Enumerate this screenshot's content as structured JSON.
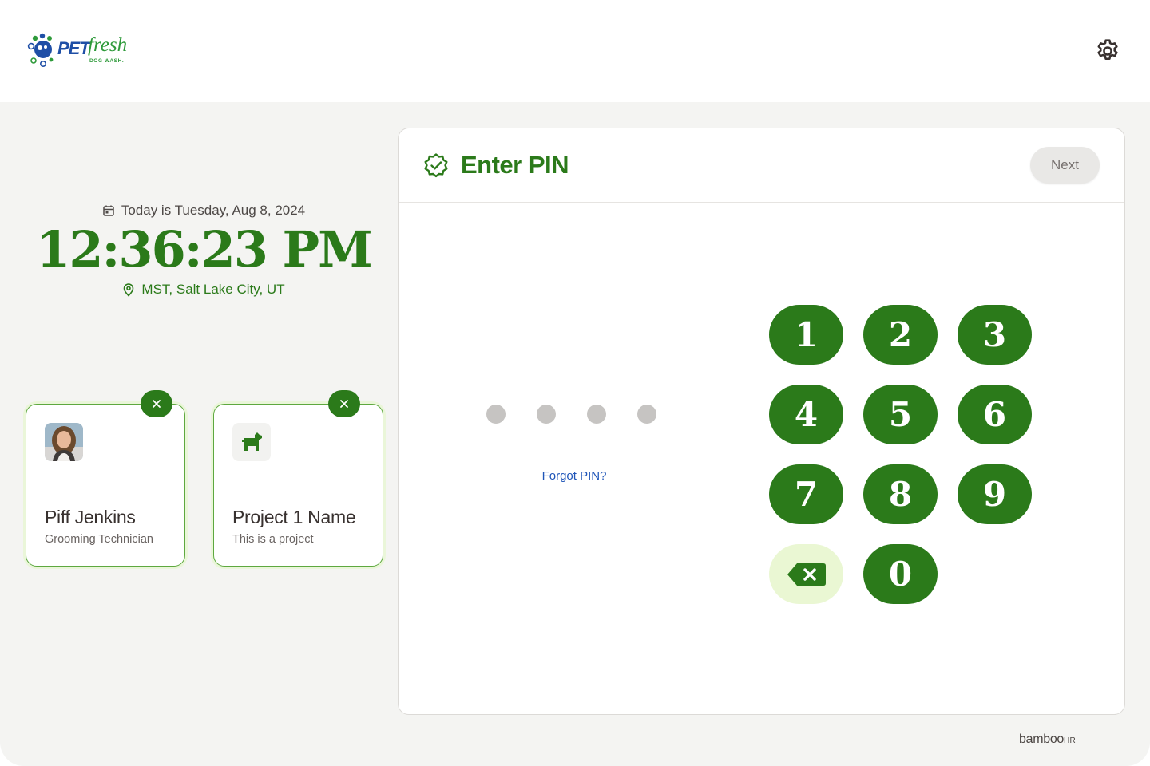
{
  "brand": {
    "pet": "PET",
    "fresh": "fresh",
    "sub": "DOG WASH."
  },
  "datetime": {
    "date_text": "Today is Tuesday, Aug 8, 2024",
    "time": "12:36:23 PM",
    "location": "MST, Salt Lake City, UT"
  },
  "selected": {
    "employee": {
      "name": "Piff Jenkins",
      "role": "Grooming Technician"
    },
    "project": {
      "name": "Project 1 Name",
      "description": "This is a project"
    }
  },
  "panel": {
    "title": "Enter PIN",
    "next_label": "Next",
    "pin_length": 4,
    "pin_entered": 0,
    "forgot_label": "Forgot PIN?"
  },
  "keypad": {
    "k1": "1",
    "k2": "2",
    "k3": "3",
    "k4": "4",
    "k5": "5",
    "k6": "6",
    "k7": "7",
    "k8": "8",
    "k9": "9",
    "k0": "0"
  },
  "footer": {
    "bamboo": "bamboo",
    "hr": "HR"
  },
  "colors": {
    "accent": "#2b7a1a",
    "backspace_bg": "#eaf7d3",
    "link": "#1f55b8",
    "background": "#f4f4f2"
  },
  "icons": [
    "paw-logo-icon",
    "gear-icon",
    "calendar-icon",
    "location-pin-icon",
    "close-icon",
    "dog-icon",
    "verified-badge-icon",
    "backspace-icon"
  ]
}
